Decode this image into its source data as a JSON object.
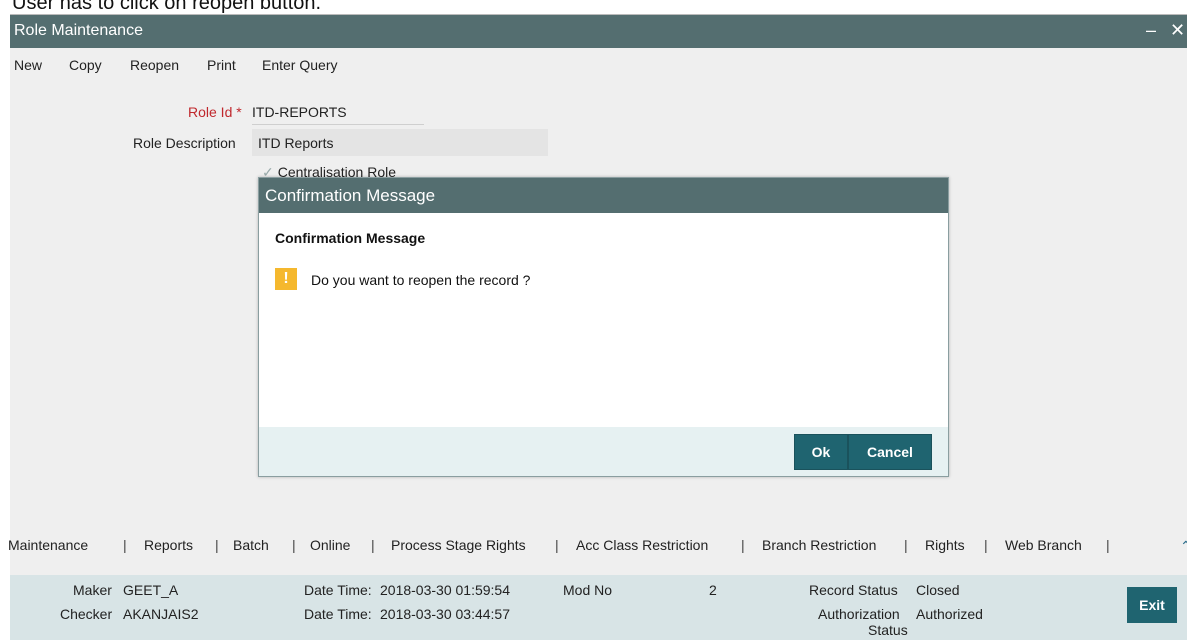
{
  "caption": "User has to click on reopen button.",
  "window": {
    "title": "Role Maintenance",
    "minimize_glyph": "–",
    "close_glyph": "✕"
  },
  "toolbar": {
    "new": "New",
    "copy": "Copy",
    "reopen": "Reopen",
    "print": "Print",
    "enter_query": "Enter Query"
  },
  "form": {
    "role_id_label": "Role Id",
    "role_id_required": "*",
    "role_id_value": "ITD-REPORTS",
    "role_description_label": "Role Description",
    "role_description_value": "ITD Reports",
    "centralisation_role_label": "Centralisation Role",
    "centralisation_role_checked": true
  },
  "dialog": {
    "title": "Confirmation Message",
    "heading": "Confirmation Message",
    "icon": "warning-icon",
    "icon_glyph": "!",
    "message": "Do you want to reopen the record ?",
    "ok_label": "Ok",
    "cancel_label": "Cancel"
  },
  "tabs": [
    "Maintenance",
    "Reports",
    "Batch",
    "Online",
    "Process Stage Rights",
    "Acc Class Restriction",
    "Branch Restriction",
    "Rights",
    "Web Branch"
  ],
  "tab_separator": "|",
  "audit": {
    "maker_label": "Maker",
    "maker_value": "GEET_A",
    "maker_datetime_label": "Date Time:",
    "maker_datetime_value": "2018-03-30 01:59:54",
    "checker_label": "Checker",
    "checker_value": "AKANJAIS2",
    "checker_datetime_label": "Date Time:",
    "checker_datetime_value": "2018-03-30 03:44:57",
    "mod_no_label": "Mod No",
    "mod_no_value": "2",
    "record_status_label": "Record Status",
    "record_status_value": "Closed",
    "authorization_status_label_1": "Authorization",
    "authorization_status_label_2": "Status",
    "authorization_status_value": "Authorized"
  },
  "exit_label": "Exit",
  "colors": {
    "titlebar": "#546e70",
    "button": "#1f6470",
    "required": "#c0282d",
    "warning": "#f5b82e"
  }
}
